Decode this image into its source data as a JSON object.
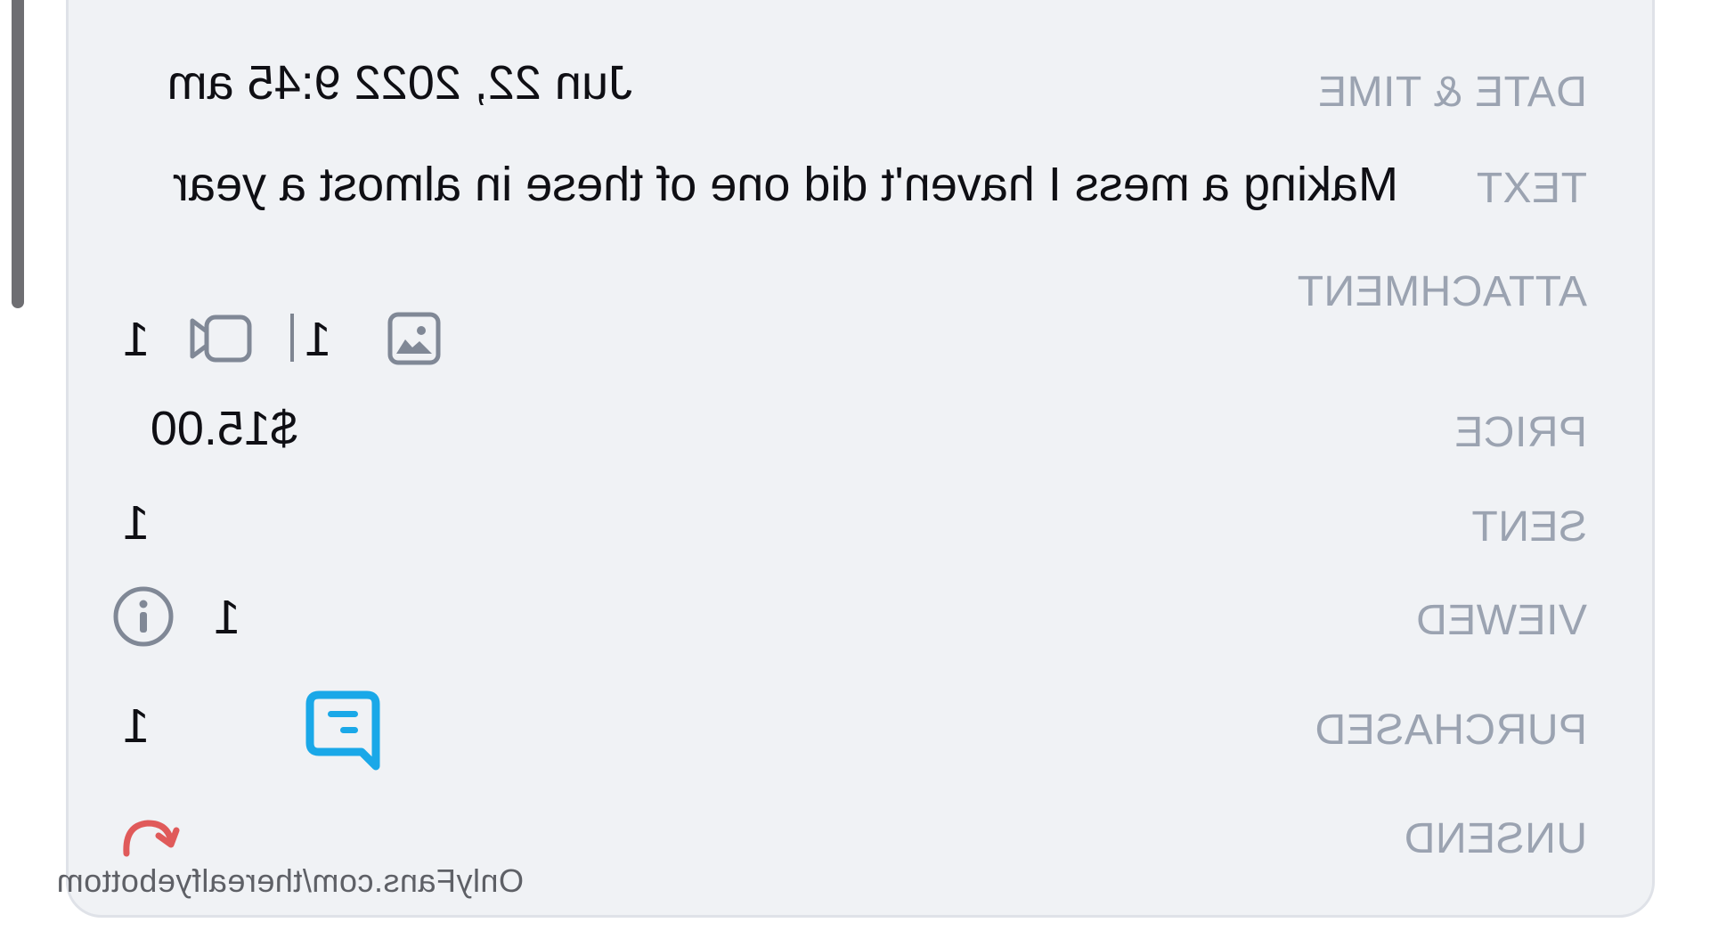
{
  "details": {
    "date_time": {
      "label": "DATE & TIME",
      "value": "Jun 22, 2022 9:45 am"
    },
    "text": {
      "label": "TEXT",
      "value": "Making a mess I haven't did one of these in almost a year"
    },
    "attachment": {
      "label": "ATTACHMENT",
      "photo_count": "1",
      "photo_icon": "image-icon",
      "video_count": "1",
      "video_icon": "video-camera-icon"
    },
    "price": {
      "label": "PRICE",
      "value": "$15.00"
    },
    "sent": {
      "label": "SENT",
      "value": "1"
    },
    "viewed": {
      "label": "VIEWED",
      "value": "1",
      "icon": "info-icon"
    },
    "purchased": {
      "label": "PURCHASED",
      "value": "1",
      "icon": "chat-bubble-icon"
    },
    "unsend": {
      "label": "UNSEND",
      "icon": "undo-arrow-icon"
    }
  },
  "watermark": "OnlyFans.com/therealfyebottom",
  "colors": {
    "card_background": "#f0f2f5",
    "label": "#9ba3b1",
    "value": "#0f0f14",
    "chat_icon": "#1aa8e8",
    "unsend_icon": "#e05a5a"
  }
}
